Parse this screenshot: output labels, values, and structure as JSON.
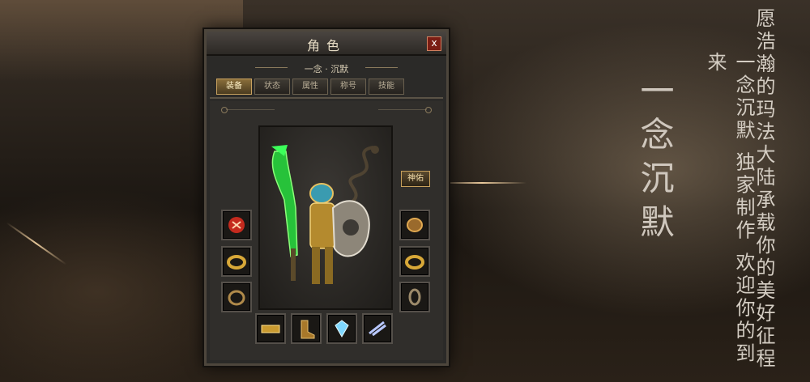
{
  "window": {
    "title": "角色",
    "close_label": "x",
    "character_name": "一念 · 沉默"
  },
  "tabs": [
    {
      "label": "装备",
      "active": true
    },
    {
      "label": "状态",
      "active": false
    },
    {
      "label": "属性",
      "active": false
    },
    {
      "label": "称号",
      "active": false
    },
    {
      "label": "技能",
      "active": false
    }
  ],
  "blessing_button": "神佑",
  "equipment_slots": {
    "left": [
      "helmet-emblem-icon",
      "ring-icon",
      "bracelet-icon"
    ],
    "right": [
      "gauntlet-icon",
      "ring-icon",
      "bracelet-icon"
    ],
    "bottom": [
      "belt-icon",
      "boots-icon",
      "gem-icon",
      "talisman-icon"
    ]
  },
  "promo": {
    "headline": "一念沉默",
    "line2": "一念沉默 独家制作 欢迎你的到来",
    "line3": "愿浩瀚的玛法大陆承载你的美好征程"
  },
  "colors": {
    "panel": "#2b2a28",
    "accent_gold": "#c9a260",
    "close_red": "#7a1d14",
    "weapon_green": "#28c93a"
  }
}
